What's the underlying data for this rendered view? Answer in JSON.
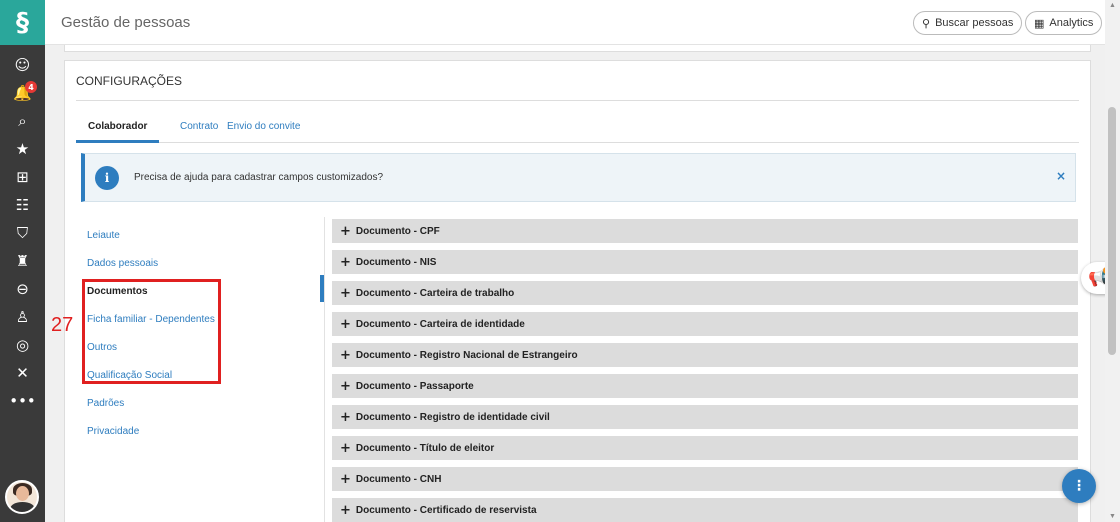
{
  "app": {
    "title": "Gestão de pessoas"
  },
  "header": {
    "search_label": "Buscar pessoas",
    "analytics_label": "Analytics"
  },
  "sidebar": {
    "notification_count": "4"
  },
  "section": {
    "title": "CONFIGURAÇÕES"
  },
  "tabs": [
    "Colaborador",
    "Contrato",
    "Envio do convite"
  ],
  "alert": {
    "text": "Precisa de ajuda para cadastrar campos customizados?",
    "close": "×"
  },
  "menu": [
    "Leiaute",
    "Dados pessoais",
    "Documentos",
    "Ficha familiar - Dependentes",
    "Outros",
    "Qualificação Social",
    "Padrões",
    "Privacidade"
  ],
  "annotation": {
    "number": "27"
  },
  "documents": [
    "Documento - CPF",
    "Documento - NIS",
    "Documento - Carteira de trabalho",
    "Documento - Carteira de identidade",
    "Documento - Registro Nacional de Estrangeiro",
    "Documento - Passaporte",
    "Documento - Registro de identidade civil",
    "Documento - Título de eleitor",
    "Documento - CNH",
    "Documento - Certificado de reservista"
  ],
  "colors": {
    "brand": "#2aa79b",
    "accent": "#2e7dbf",
    "rail": "#3a3a3a",
    "annotation": "#e02020"
  }
}
